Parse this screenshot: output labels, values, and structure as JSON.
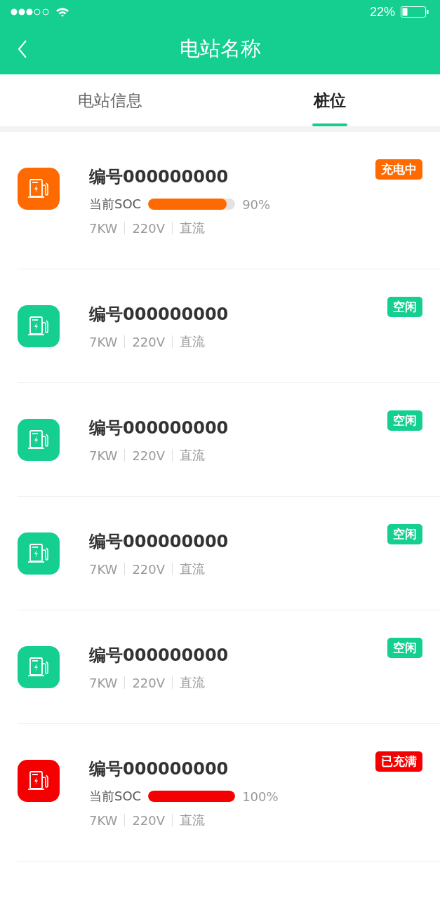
{
  "status_bar": {
    "battery_text": "22%"
  },
  "nav_bar": {
    "title": "电站名称"
  },
  "tabs": [
    {
      "label": "电站信息",
      "selected": false
    },
    {
      "label": "桩位",
      "selected": true
    }
  ],
  "piles": [
    {
      "number": "编号000000000",
      "status": "充电中",
      "color": "#ff6a00",
      "soc": {
        "label": "当前SOC",
        "level": 0.9,
        "reading": "90%"
      },
      "specs": [
        "7KW",
        "220V",
        "直流"
      ]
    },
    {
      "number": "编号000000000",
      "status": "空闲",
      "color": "#14cf8f",
      "specs": [
        "7KW",
        "220V",
        "直流"
      ]
    },
    {
      "number": "编号000000000",
      "status": "空闲",
      "color": "#14cf8f",
      "specs": [
        "7KW",
        "220V",
        "直流"
      ]
    },
    {
      "number": "编号000000000",
      "status": "空闲",
      "color": "#14cf8f",
      "specs": [
        "7KW",
        "220V",
        "直流"
      ]
    },
    {
      "number": "编号000000000",
      "status": "空闲",
      "color": "#14cf8f",
      "specs": [
        "7KW",
        "220V",
        "直流"
      ]
    },
    {
      "number": "编号000000000",
      "status": "已充满",
      "color": "#f50000",
      "soc": {
        "label": "当前SOC",
        "level": 1,
        "reading": "100%"
      },
      "specs": [
        "7KW",
        "220V",
        "直流"
      ]
    }
  ]
}
